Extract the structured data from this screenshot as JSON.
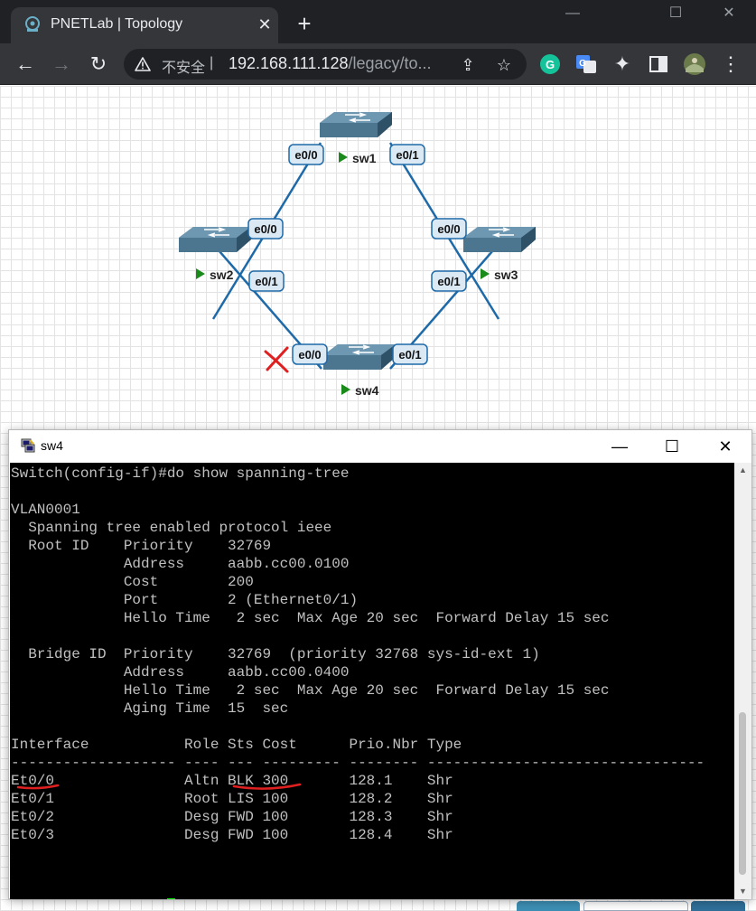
{
  "browser": {
    "tab_title": "PNETLab | Topology",
    "tab_close": "✕",
    "new_tab": "+",
    "security_label": "不安全",
    "url_host": "192.168.111.128",
    "url_path": "/legacy/to...",
    "window_controls": [
      "—",
      "☐",
      "✕"
    ]
  },
  "topology": {
    "nodes": [
      {
        "name": "sw1"
      },
      {
        "name": "sw2"
      },
      {
        "name": "sw3"
      },
      {
        "name": "sw4"
      }
    ],
    "ports": {
      "sw1_left": "e0/0",
      "sw1_right": "e0/1",
      "sw2_top": "e0/0",
      "sw2_bottom": "e0/1",
      "sw3_top": "e0/0",
      "sw3_bottom": "e0/1",
      "sw4_left": "e0/0",
      "sw4_right": "e0/1"
    },
    "colors": {
      "link": "#1e6aa8",
      "switch_top": "#5f8aa3",
      "switch_side": "#3d6580",
      "run_arrow": "#1a8a1a",
      "annotation": "#e02020"
    }
  },
  "console": {
    "title": "sw4",
    "controls": [
      "—",
      "☐",
      "✕"
    ],
    "lines": [
      "Switch(config-if)#do show spanning-tree",
      "",
      "VLAN0001",
      "  Spanning tree enabled protocol ieee",
      "  Root ID    Priority    32769",
      "             Address     aabb.cc00.0100",
      "             Cost        200",
      "             Port        2 (Ethernet0/1)",
      "             Hello Time   2 sec  Max Age 20 sec  Forward Delay 15 sec",
      "",
      "  Bridge ID  Priority    32769  (priority 32768 sys-id-ext 1)",
      "             Address     aabb.cc00.0400",
      "             Hello Time   2 sec  Max Age 20 sec  Forward Delay 15 sec",
      "             Aging Time  15  sec",
      "",
      "Interface           Role Sts Cost      Prio.Nbr Type",
      "------------------- ---- --- --------- -------- --------------------------------",
      "Et0/0               Altn BLK 300       128.1    Shr",
      "Et0/1               Root LIS 100       128.2    Shr",
      "Et0/2               Desg FWD 100       128.3    Shr",
      "Et0/3               Desg FWD 100       128.4    Shr",
      "",
      "",
      ""
    ],
    "prompt": "Switch(config-if)#"
  }
}
